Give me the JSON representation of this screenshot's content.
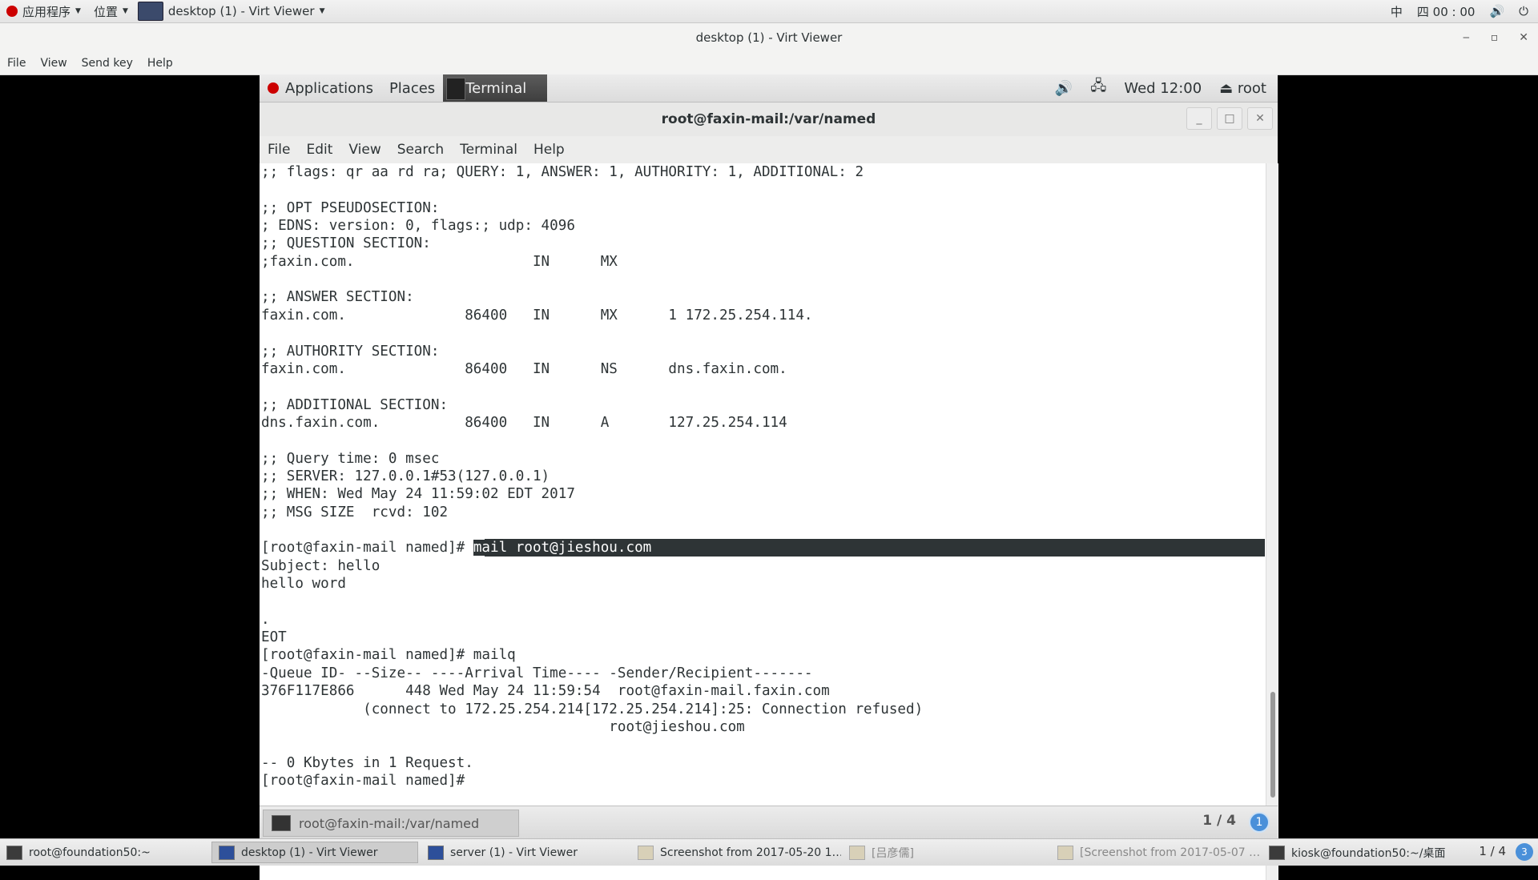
{
  "host_top": {
    "apps_label": "应用程序",
    "places_label": "位置",
    "window_label": "desktop (1) - Virt Viewer",
    "input_method": "中",
    "clock": "四 00 : 00"
  },
  "virt_viewer": {
    "title": "desktop (1) - Virt Viewer",
    "menu": [
      "File",
      "View",
      "Send key",
      "Help"
    ]
  },
  "guest_top": {
    "applications": "Applications",
    "places": "Places",
    "terminal": "Terminal",
    "clock": "Wed 12:00",
    "user": "root"
  },
  "terminal": {
    "title": "root@faxin-mail:/var/named",
    "menu": [
      "File",
      "Edit",
      "View",
      "Search",
      "Terminal",
      "Help"
    ],
    "prompt_highlight": "[root@faxin-mail named]# ",
    "highlight_command": "mail root@jieshou.com",
    "lines": [
      ";; flags: qr aa rd ra; QUERY: 1, ANSWER: 1, AUTHORITY: 1, ADDITIONAL: 2",
      "",
      ";; OPT PSEUDOSECTION:",
      "; EDNS: version: 0, flags:; udp: 4096",
      ";; QUESTION SECTION:",
      ";faxin.com.                     IN      MX",
      "",
      ";; ANSWER SECTION:",
      "faxin.com.              86400   IN      MX      1 172.25.254.114.",
      "",
      ";; AUTHORITY SECTION:",
      "faxin.com.              86400   IN      NS      dns.faxin.com.",
      "",
      ";; ADDITIONAL SECTION:",
      "dns.faxin.com.          86400   IN      A       127.25.254.114",
      "",
      ";; Query time: 0 msec",
      ";; SERVER: 127.0.0.1#53(127.0.0.1)",
      ";; WHEN: Wed May 24 11:59:02 EDT 2017",
      ";; MSG SIZE  rcvd: 102",
      "",
      "",
      "Subject: hello",
      "hello word",
      "",
      ".",
      "EOT",
      "[root@faxin-mail named]# mailq",
      "-Queue ID- --Size-- ----Arrival Time---- -Sender/Recipient-------",
      "376F117E866      448 Wed May 24 11:59:54  root@faxin-mail.faxin.com",
      "            (connect to 172.25.254.214[172.25.254.214]:25: Connection refused)",
      "                                         root@jieshou.com",
      "",
      "-- 0 Kbytes in 1 Request.",
      "[root@faxin-mail named]# "
    ]
  },
  "guest_bottom": {
    "task_label": "root@faxin-mail:/var/named",
    "workspace": "1 / 4",
    "workspace_num": "1"
  },
  "host_bottom": {
    "tasks": [
      "root@foundation50:~",
      "desktop (1) - Virt Viewer",
      "server (1) - Virt Viewer",
      "Screenshot from 2017-05-20 1…",
      "[吕彦儒]",
      "[Screenshot from 2017-05-07 …",
      "kiosk@foundation50:~/桌面"
    ],
    "workspace": "1 / 4",
    "workspace_num": "3"
  }
}
